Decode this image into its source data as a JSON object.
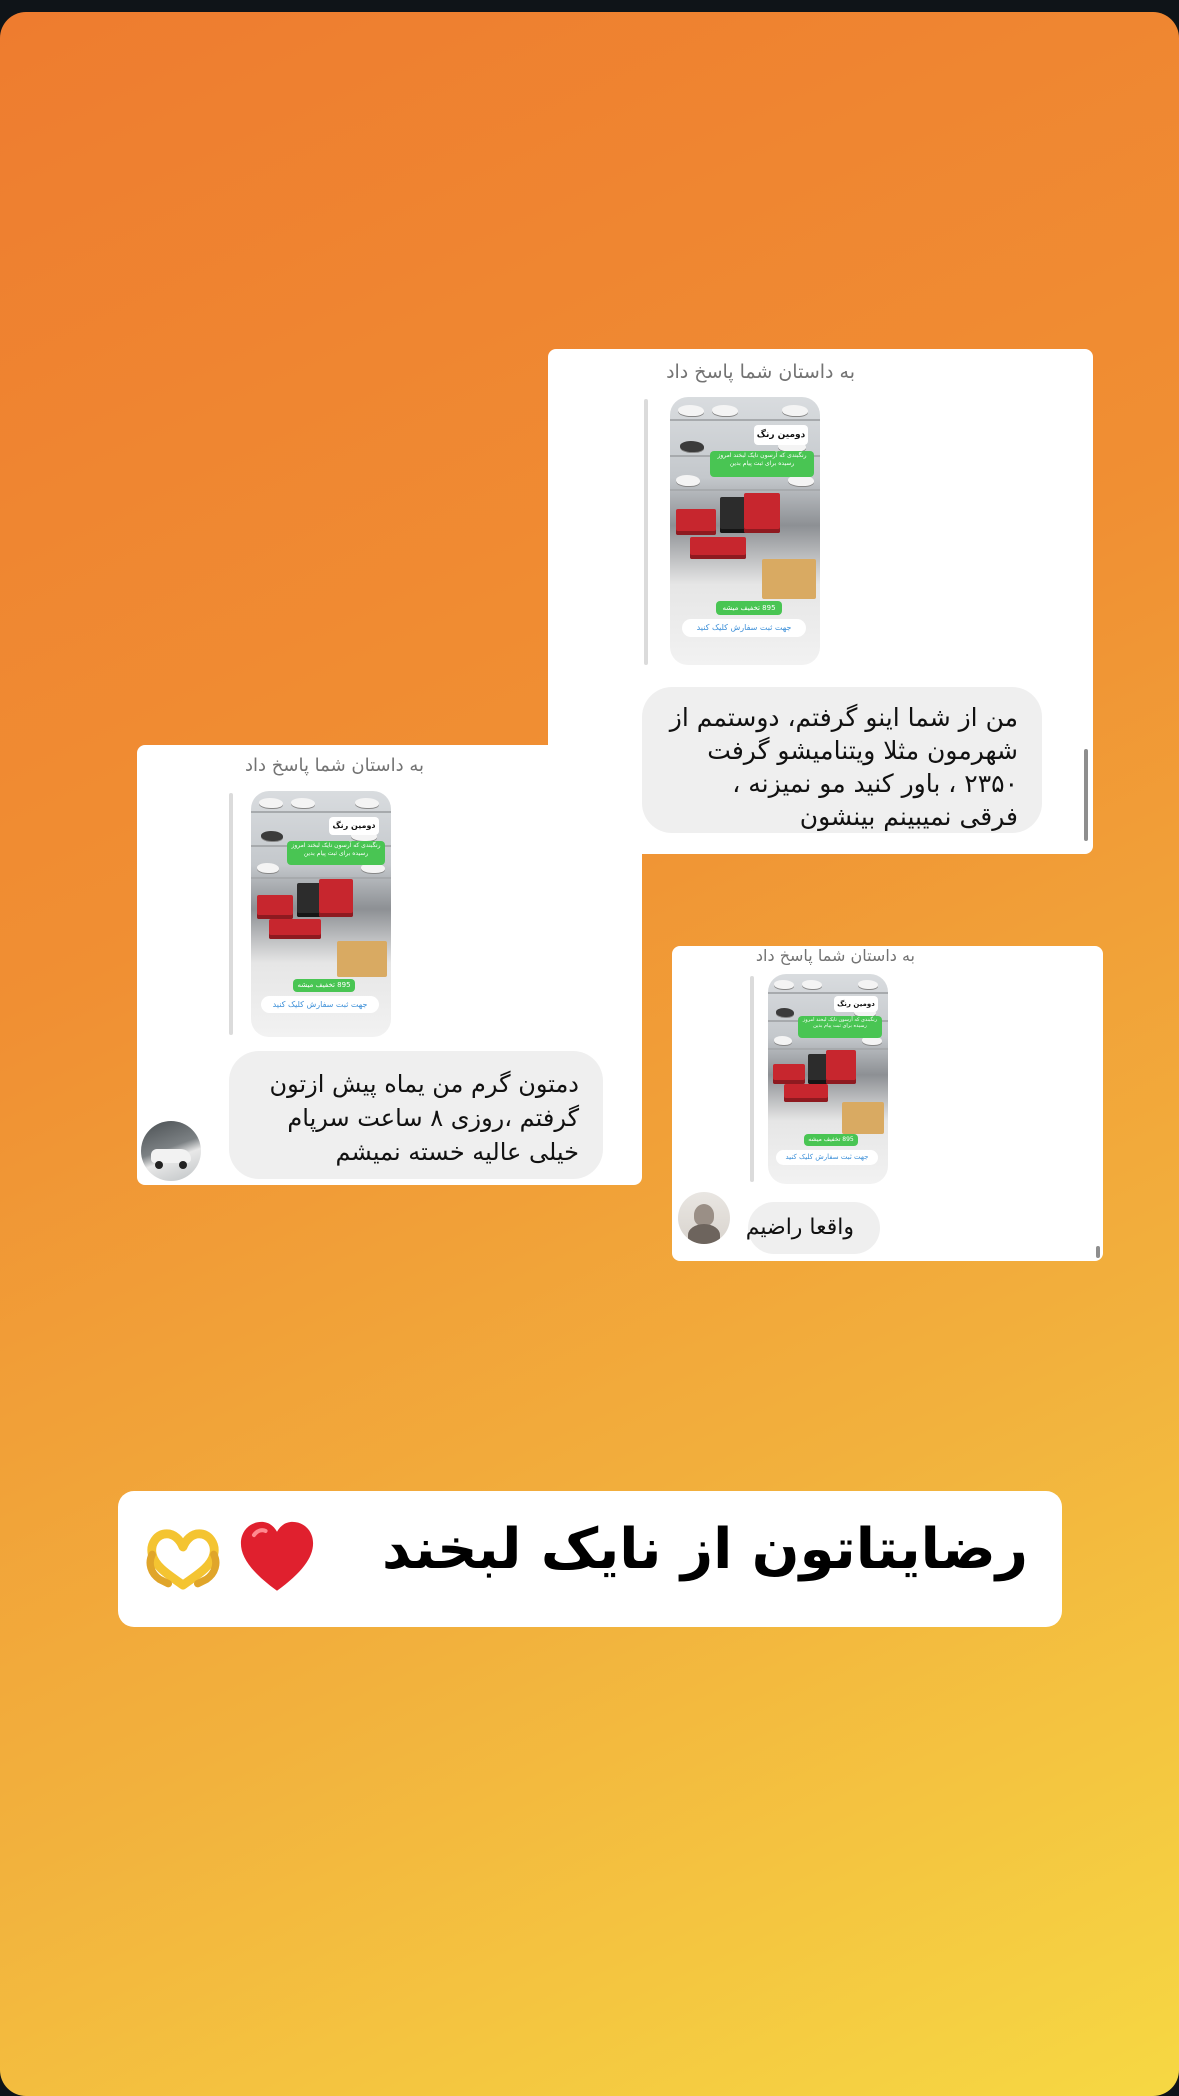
{
  "cards": [
    {
      "reply_label": "به داستان شما پاسخ داد",
      "thumb": {
        "title": "دومین رنگ",
        "green_text": "رنگبندی که آرسون نایک لبخند امروز رسیده برای ثبت پیام بدین",
        "price_text": "895 تخفیف میشه",
        "pill_text": "جهت ثبت سفارش کلیک کنید"
      },
      "message": "من از شما اینو گرفتم، دوستمم از شهرمون مثلا ویتنامیشو گرفت ۲۳۵۰ ، باور کنید مو نمیزنه ، فرقی نمیبینم بینشون"
    },
    {
      "reply_label": "به داستان شما پاسخ داد",
      "thumb": {
        "title": "دومین رنگ",
        "green_text": "رنگبندی که آرسون نایک لبخند امروز رسیده برای ثبت پیام بدین",
        "price_text": "895 تخفیف میشه",
        "pill_text": "جهت ثبت سفارش کلیک کنید"
      },
      "message": "دمتون گرم من یماه پیش ازتون گرفتم ،روزی ۸ ساعت سرپام خیلی عالیه خسته نمیشم"
    },
    {
      "reply_label": "به داستان شما پاسخ داد",
      "thumb": {
        "title": "دومین رنگ",
        "green_text": "رنگبندی که آرسون نایک لبخند امروز رسیده برای ثبت پیام بدین",
        "price_text": "895 تخفیف میشه",
        "pill_text": "جهت ثبت سفارش کلیک کنید"
      },
      "message": "واقعا راضیم"
    }
  ],
  "caption": {
    "text": "رضایتاتون از نایک لبخند"
  },
  "icons": {
    "heart": "red-heart-icon",
    "hands": "heart-hands-icon"
  },
  "colors": {
    "gradient_start": "#ee7c2f",
    "gradient_end": "#f6d843",
    "card": "#ffffff",
    "bubble": "#efefef",
    "heart": "#e0202e",
    "hands": "#f4c431"
  }
}
